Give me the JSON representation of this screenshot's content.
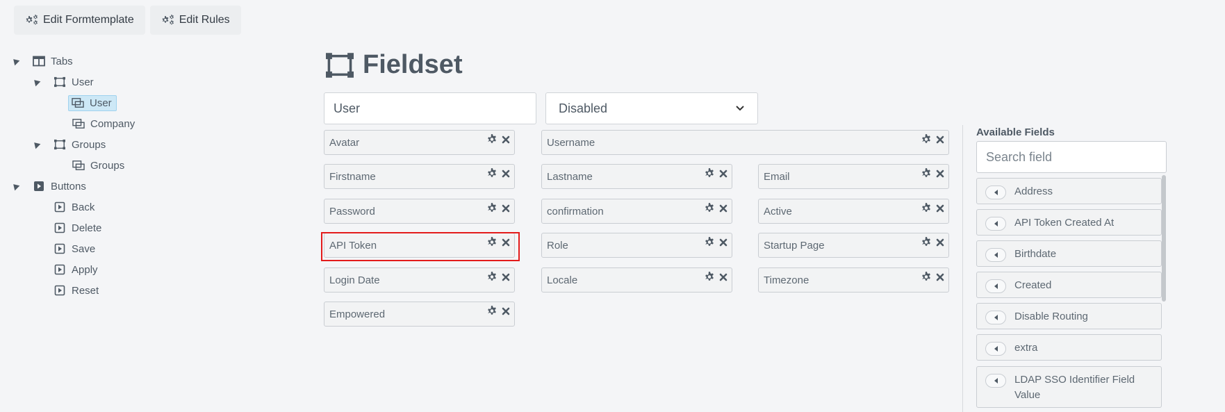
{
  "toolbar": {
    "edit_formtemplate": "Edit Formtemplate",
    "edit_rules": "Edit Rules"
  },
  "tree": {
    "tabs": "Tabs",
    "user_tab": "User",
    "user_fieldset": "User",
    "company_fieldset": "Company",
    "groups_tab": "Groups",
    "groups_fieldset": "Groups",
    "buttons": "Buttons",
    "back": "Back",
    "delete": "Delete",
    "save": "Save",
    "apply": "Apply",
    "reset": "Reset"
  },
  "fieldset": {
    "title": "Fieldset",
    "name_value": "User",
    "state_value": "Disabled"
  },
  "fields": {
    "avatar": "Avatar",
    "username": "Username",
    "firstname": "Firstname",
    "lastname": "Lastname",
    "email": "Email",
    "password": "Password",
    "confirmation": "confirmation",
    "active": "Active",
    "api_token": "API Token",
    "role": "Role",
    "startup_page": "Startup Page",
    "login_date": "Login Date",
    "locale": "Locale",
    "timezone": "Timezone",
    "empowered": "Empowered"
  },
  "available": {
    "title": "Available Fields",
    "search_placeholder": "Search field",
    "items": [
      "Address",
      "API Token Created At",
      "Birthdate",
      "Created",
      "Disable Routing",
      "extra",
      "LDAP SSO Identifier Field Value"
    ]
  },
  "colors": {
    "highlight": "#e31b1b",
    "selected_bg": "#cde8f6"
  }
}
